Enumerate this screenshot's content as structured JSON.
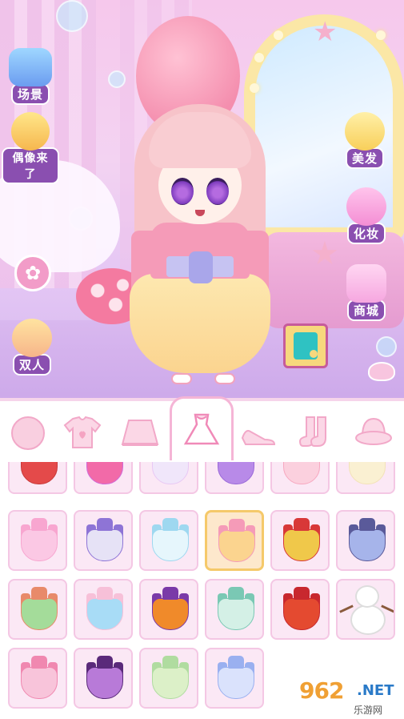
{
  "side_menu_left": {
    "scene_label": "场景",
    "idol_label": "偶像来了",
    "duo_label": "双人"
  },
  "side_menu_right": {
    "hair_label": "美发",
    "makeup_label": "化妆",
    "shop_label": "商城"
  },
  "colors": {
    "label_bg": "#8a4fb0",
    "tab_active_border": "#f5b5d6",
    "item_bg": "#fbe8f5",
    "item_selected_border": "#f5c96a"
  },
  "category_tabs": [
    {
      "icon": "face-icon"
    },
    {
      "icon": "shirt-icon"
    },
    {
      "icon": "skirt-icon"
    },
    {
      "icon": "dress-icon",
      "active": true
    },
    {
      "icon": "shoes-icon"
    },
    {
      "icon": "socks-icon"
    },
    {
      "icon": "hat-icon"
    }
  ],
  "grid_items": [
    {
      "kind": "dress",
      "top": "#c83a3a",
      "skirt": "#e44a4a",
      "selected": false
    },
    {
      "kind": "dress",
      "top": "#d06ad8",
      "skirt": "#f26aa8",
      "selected": false
    },
    {
      "kind": "dress",
      "top": "#e8c8f4",
      "skirt": "#f0e6fa",
      "selected": false
    },
    {
      "kind": "dress",
      "top": "#9a6ad8",
      "skirt": "#b88ae8",
      "selected": false
    },
    {
      "kind": "dress",
      "top": "#f7a8c0",
      "skirt": "#fbd0de",
      "selected": false
    },
    {
      "kind": "dress",
      "top": "#f3e2b8",
      "skirt": "#faf0d2",
      "selected": false
    },
    {
      "kind": "dress",
      "top": "#f8a6d0",
      "skirt": "#fbc8e4",
      "selected": false
    },
    {
      "kind": "dress",
      "top": "#8e74d6",
      "skirt": "#e6e2f6",
      "selected": false
    },
    {
      "kind": "dress",
      "top": "#9ed8f0",
      "skirt": "#e6f6fc",
      "selected": false
    },
    {
      "kind": "dress",
      "top": "#f59bb8",
      "skirt": "#fbd48f",
      "selected": true
    },
    {
      "kind": "dress",
      "top": "#d83838",
      "skirt": "#f0c84a",
      "selected": false
    },
    {
      "kind": "dress",
      "top": "#5a5a9a",
      "skirt": "#a6b4ea",
      "selected": false
    },
    {
      "kind": "dress",
      "top": "#e88a6a",
      "skirt": "#a4dc9a",
      "selected": false
    },
    {
      "kind": "dress",
      "top": "#f7c0d8",
      "skirt": "#a8dcf6",
      "selected": false
    },
    {
      "kind": "dress",
      "top": "#7a3aa8",
      "skirt": "#f08a2a",
      "selected": false
    },
    {
      "kind": "dress",
      "top": "#7ac8b4",
      "skirt": "#d4f0e6",
      "selected": false
    },
    {
      "kind": "dress",
      "top": "#c8282e",
      "skirt": "#e44a30",
      "selected": false
    },
    {
      "kind": "snowman",
      "top": "#ffffff",
      "skirt": "#ffffff",
      "selected": false
    },
    {
      "kind": "dress",
      "top": "#f088b0",
      "skirt": "#f8c4da",
      "selected": false
    },
    {
      "kind": "dress",
      "top": "#5a2a7a",
      "skirt": "#b87ad8",
      "selected": false
    },
    {
      "kind": "dress",
      "top": "#b0dca0",
      "skirt": "#dcf0c8",
      "selected": false
    },
    {
      "kind": "dress",
      "top": "#9ab0f0",
      "skirt": "#dae2fc",
      "selected": false
    }
  ],
  "watermark": {
    "number": "962",
    "domain": ".NET",
    "subtitle": "乐游网"
  }
}
